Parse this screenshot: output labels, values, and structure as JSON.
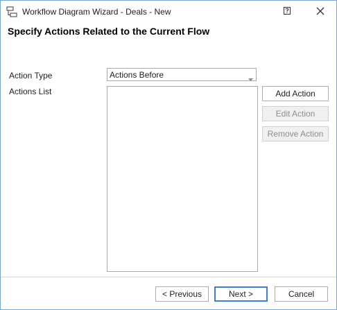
{
  "window": {
    "title": "Workflow Diagram Wizard - Deals - New",
    "help_icon": "help-icon",
    "close_icon": "close-icon",
    "app_icon": "workflow-diagram-icon"
  },
  "header": {
    "title": "Specify Actions Related to the Current Flow"
  },
  "form": {
    "action_type_label": "Action Type",
    "action_type_value": "Actions Before",
    "actions_list_label": "Actions List",
    "actions_list_items": []
  },
  "side_buttons": {
    "add": "Add Action",
    "edit": "Edit Action",
    "remove": "Remove Action"
  },
  "footer": {
    "previous": "< Previous",
    "next": "Next >",
    "cancel": "Cancel"
  },
  "colors": {
    "border_accent": "#3c7fd6",
    "disabled_text": "#8e8e8e"
  }
}
